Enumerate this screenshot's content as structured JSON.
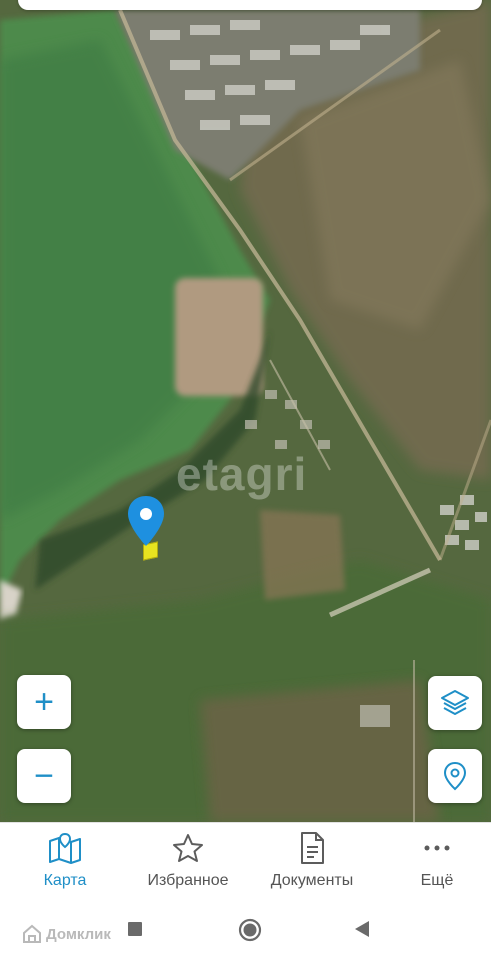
{
  "map": {
    "watermark": "etagri",
    "layers_icon": "layers-icon",
    "location_icon": "location-pin-icon",
    "zoom_in_label": "+",
    "zoom_out_label": "−",
    "accent_color": "#1f8fc7"
  },
  "tabs": [
    {
      "label": "Карта",
      "icon": "map-icon",
      "active": true
    },
    {
      "label": "Избранное",
      "icon": "star-icon",
      "active": false
    },
    {
      "label": "Документы",
      "icon": "document-icon",
      "active": false
    },
    {
      "label": "Ещё",
      "icon": "more-dots-icon",
      "active": false
    }
  ],
  "brand": {
    "name": "Домклик",
    "icon": "domclick-logo-icon"
  },
  "navbar": {
    "icons": [
      "recent-apps-icon",
      "home-icon",
      "back-icon"
    ]
  }
}
